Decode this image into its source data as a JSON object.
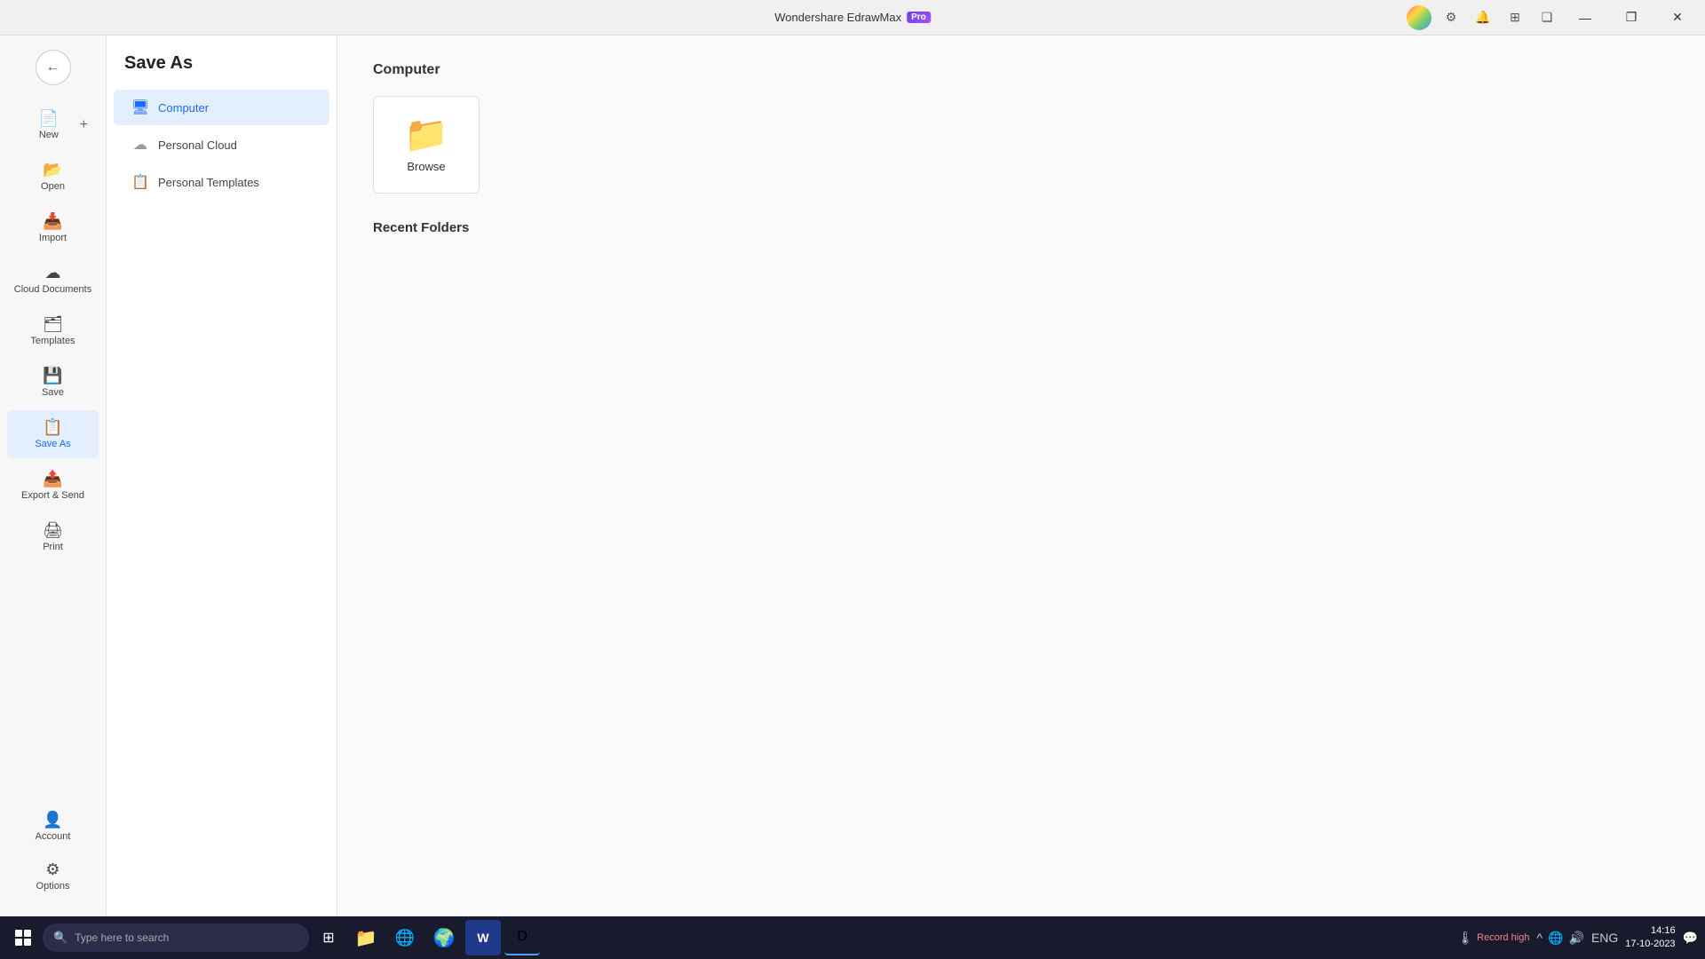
{
  "app": {
    "title": "Wondershare EdrawMax",
    "badge": "Pro"
  },
  "titlebar": {
    "minimize": "—",
    "restore": "❐",
    "close": "✕",
    "icons": {
      "settings": "⚙",
      "bell": "🔔",
      "grid": "⊞",
      "layers": "❏"
    }
  },
  "sidebar": {
    "back_label": "←",
    "items": [
      {
        "id": "new",
        "label": "New",
        "icon": "+"
      },
      {
        "id": "open",
        "label": "Open",
        "icon": "📂"
      },
      {
        "id": "import",
        "label": "Import",
        "icon": "📥"
      },
      {
        "id": "cloud-documents",
        "label": "Cloud Documents",
        "icon": "☁"
      },
      {
        "id": "templates",
        "label": "Templates",
        "icon": "🗂"
      },
      {
        "id": "save",
        "label": "Save",
        "icon": "💾"
      },
      {
        "id": "save-as",
        "label": "Save As",
        "icon": "🖫",
        "active": true
      },
      {
        "id": "export-send",
        "label": "Export & Send",
        "icon": "📤"
      },
      {
        "id": "print",
        "label": "Print",
        "icon": "🖨"
      }
    ],
    "bottom": [
      {
        "id": "account",
        "label": "Account",
        "icon": "👤"
      },
      {
        "id": "options",
        "label": "Options",
        "icon": "⚙"
      }
    ]
  },
  "panel": {
    "title": "Save As",
    "items": [
      {
        "id": "computer",
        "label": "Computer",
        "icon": "computer",
        "active": true
      },
      {
        "id": "personal-cloud",
        "label": "Personal Cloud",
        "icon": "cloud"
      },
      {
        "id": "personal-templates",
        "label": "Personal Templates",
        "icon": "templates"
      }
    ]
  },
  "main": {
    "section_title": "Computer",
    "browse_label": "Browse",
    "recent_folders_title": "Recent Folders"
  },
  "taskbar": {
    "search_placeholder": "Type here to search",
    "time": "14:16",
    "date": "17-10-2023",
    "lang": "ENG",
    "temp_label": "🌡",
    "record_high": "Record high",
    "apps": [
      "🪟",
      "🔍",
      "⊞",
      "📁",
      "🌐",
      "🌍",
      "W",
      "D"
    ]
  }
}
